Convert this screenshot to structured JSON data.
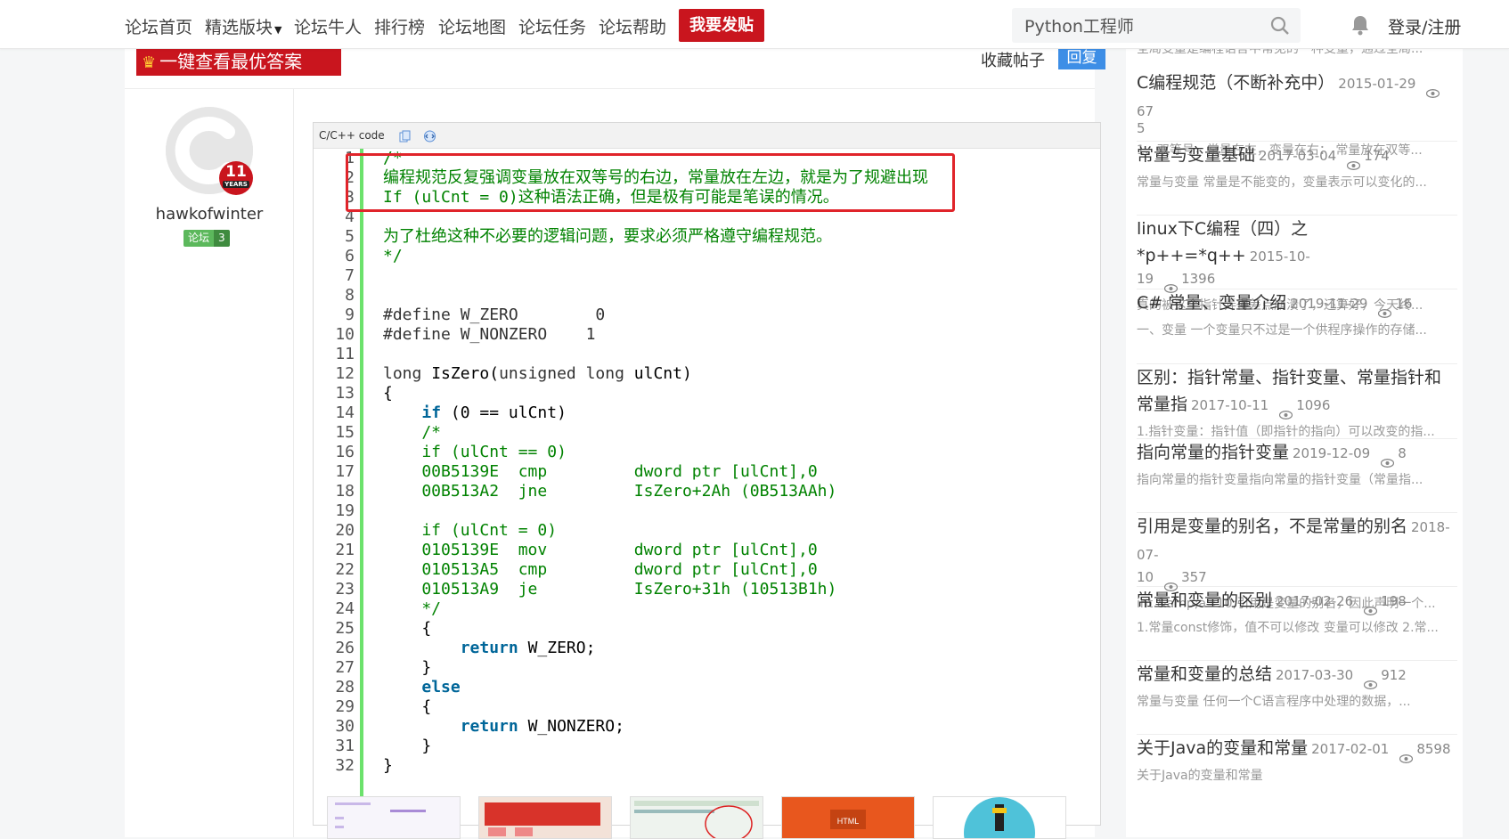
{
  "nav": {
    "items": [
      "论坛首页",
      "精选版块",
      "论坛牛人",
      "排行榜",
      "论坛地图",
      "论坛任务",
      "论坛帮助"
    ],
    "post_button": "我要发贴",
    "search_value": "Python工程师",
    "login": "登录/注册"
  },
  "thread": {
    "best_answer_button": "一键查看最优答案",
    "favorite": "收藏帖子",
    "reply": "回复"
  },
  "author": {
    "years": "11",
    "years_label": "YEARS",
    "name": "hawkofwinter",
    "badge_label": "论坛",
    "badge_level": "3"
  },
  "code": {
    "language": "C/C++ code",
    "line_numbers": [
      "1",
      "2",
      "3",
      "4",
      "5",
      "6",
      "7",
      "8",
      "9",
      "10",
      "11",
      "12",
      "13",
      "14",
      "15",
      "16",
      "17",
      "18",
      "19",
      "20",
      "21",
      "22",
      "23",
      "24",
      "25",
      "26",
      "27",
      "28",
      "29",
      "30",
      "31",
      "32"
    ],
    "lines": [
      [
        {
          "t": "/*",
          "c": "cm"
        }
      ],
      [
        {
          "t": "编程规范反复强调变量放在双等号的右边，常量放在左边，就是为了规避出现",
          "c": "cm cn"
        }
      ],
      [
        {
          "t": "If (ulCnt = 0)",
          "c": "cm"
        },
        {
          "t": "这种语法正确，但是极有可能是笔误的情况。",
          "c": "cm cn"
        }
      ],
      [],
      [
        {
          "t": "为了杜绝这种不必要的逻辑问题，要求必须严格遵守编程规范。",
          "c": "cm cn"
        }
      ],
      [
        {
          "t": "*/",
          "c": "cm"
        }
      ],
      [],
      [],
      [
        {
          "t": "#define W_ZERO        0",
          "c": "ty"
        }
      ],
      [
        {
          "t": "#define W_NONZERO    1",
          "c": "ty"
        }
      ],
      [],
      [
        {
          "t": "long",
          "c": "ty"
        },
        {
          "t": " IsZero(",
          "c": ""
        },
        {
          "t": "unsigned long",
          "c": "ty"
        },
        {
          "t": " ulCnt)",
          "c": ""
        }
      ],
      [
        {
          "t": "{",
          "c": ""
        }
      ],
      [
        {
          "t": "    ",
          "c": ""
        },
        {
          "t": "if",
          "c": "kw"
        },
        {
          "t": " (0 == ulCnt)",
          "c": ""
        }
      ],
      [
        {
          "t": "    /*",
          "c": "cm"
        }
      ],
      [
        {
          "t": "    if (ulCnt == 0)",
          "c": "cm"
        }
      ],
      [
        {
          "t": "    00B5139E  cmp         dword ptr [ulCnt],0",
          "c": "cm"
        }
      ],
      [
        {
          "t": "    00B513A2  jne         IsZero+2Ah (0B513AAh)",
          "c": "cm"
        }
      ],
      [],
      [
        {
          "t": "    if (ulCnt = 0)",
          "c": "cm"
        }
      ],
      [
        {
          "t": "    0105139E  mov         dword ptr [ulCnt],0",
          "c": "cm"
        }
      ],
      [
        {
          "t": "    010513A5  cmp         dword ptr [ulCnt],0",
          "c": "cm"
        }
      ],
      [
        {
          "t": "    010513A9  je          IsZero+31h (10513B1h)",
          "c": "cm"
        }
      ],
      [
        {
          "t": "    */",
          "c": "cm"
        }
      ],
      [
        {
          "t": "    {",
          "c": ""
        }
      ],
      [
        {
          "t": "        ",
          "c": ""
        },
        {
          "t": "return",
          "c": "kw"
        },
        {
          "t": " W_ZERO;",
          "c": ""
        }
      ],
      [
        {
          "t": "    }",
          "c": ""
        }
      ],
      [
        {
          "t": "    ",
          "c": ""
        },
        {
          "t": "else",
          "c": "kw"
        }
      ],
      [
        {
          "t": "    {",
          "c": ""
        }
      ],
      [
        {
          "t": "        ",
          "c": ""
        },
        {
          "t": "return",
          "c": "kw"
        },
        {
          "t": " W_NONZERO;",
          "c": ""
        }
      ],
      [
        {
          "t": "    }",
          "c": ""
        }
      ],
      [
        {
          "t": "}",
          "c": ""
        }
      ]
    ]
  },
  "sidebar": {
    "top_snippet": "全局变量是编程语言中常见的一种变量，通过全局...",
    "items": [
      {
        "title": "C编程规范（不断补充中）",
        "date": "2015-01-29",
        "views": "67",
        "extra": "5",
        "snippet": "1、双等号，常量在左，变量在右：  常量放在双等..."
      },
      {
        "title": "常量与变量基础",
        "date": "2017-03-04",
        "views": "174",
        "snippet": "常量与变量 常量是不能变的，变量表示可以变化的..."
      },
      {
        "title": "linux下C编程（四）之*p++=*q++",
        "date": "2015-10-",
        "date2": "19",
        "views": "1396",
        "snippet": "真的被这个指针弄得差点崩溃了，还算好，今天终..."
      },
      {
        "title": "C# 常量、变量介绍",
        "date": "2019-11-29",
        "views": "16",
        "snippet": "一、变量 一个变量只不过是一个供程序操作的存储..."
      },
      {
        "title": "区别：指针常量、指针变量、常量指针和常量指",
        "date": "2017-10-11",
        "views": "1096",
        "snippet": "1.指针变量：指针值（即指针的指向）可以改变的指..."
      },
      {
        "title": "指向常量的指针变量",
        "date": "2019-12-09",
        "views": "8",
        "snippet": "指向常量的指针变量指向常量的指针变量（常量指..."
      },
      {
        "title": "引用是变量的别名，不是常量的别名",
        "date": "2018-07-",
        "date2": "10",
        "views": "357",
        "snippet": "int &amp;a=10;引用是变量的别名，因此声明一个..."
      },
      {
        "title": "常量和变量的区别",
        "date": "2017-02-26",
        "views": "198",
        "snippet": "1.常量const修饰，值不可以修改 变量可以修改 2.常..."
      },
      {
        "title": "常量和变量的总结",
        "date": "2017-03-30",
        "views": "912",
        "snippet": "常量与变量        任何一个C语言程序中处理的数据，..."
      },
      {
        "title": "关于Java的变量和常量",
        "date": "2017-02-01",
        "views": "8598",
        "snippet": "关于Java的变量和常量"
      }
    ]
  },
  "colors": {
    "brand_red": "#c9151e",
    "reply_blue": "#3d8ee6",
    "comment_green": "#008200",
    "keyword_blue": "#006699",
    "gutter_green": "#6ce26c",
    "highlight_red": "#e0242a"
  }
}
